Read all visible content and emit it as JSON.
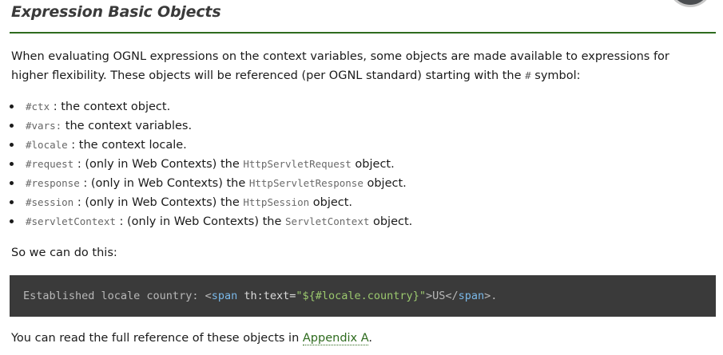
{
  "heading": "Expression Basic Objects",
  "intro": {
    "part1": "When evaluating OGNL expressions on the context variables, some objects are made available to expressions for higher flexibility. These objects will be referenced (per OGNL standard) starting with the ",
    "hash": "#",
    "part2": " symbol:"
  },
  "objects": [
    {
      "key": "#ctx",
      "sep": " : ",
      "text1": "the context object.",
      "type": "",
      "text2": ""
    },
    {
      "key": "#vars:",
      "sep": "  ",
      "text1": "the context variables.",
      "type": "",
      "text2": ""
    },
    {
      "key": "#locale",
      "sep": " : ",
      "text1": "the context locale.",
      "type": "",
      "text2": ""
    },
    {
      "key": "#request",
      "sep": " : ",
      "text1": "(only in Web Contexts) the ",
      "type": "HttpServletRequest",
      "text2": " object."
    },
    {
      "key": "#response",
      "sep": " : ",
      "text1": "(only in Web Contexts) the ",
      "type": "HttpServletResponse",
      "text2": " object."
    },
    {
      "key": "#session",
      "sep": " : ",
      "text1": "(only in Web Contexts) the ",
      "type": "HttpSession",
      "text2": " object."
    },
    {
      "key": "#servletContext",
      "sep": " : ",
      "text1": "(only in Web Contexts) the ",
      "type": "ServletContext",
      "text2": " object."
    }
  ],
  "so_we_can": "So we can do this:",
  "code": {
    "prefix": "Established locale country: ",
    "lt": "<",
    "tag": "span",
    "attr": " th:text=",
    "value": "\"${#locale.country}\"",
    "content": ">US</",
    "tag_close": "span",
    "suffix": ">."
  },
  "outro": {
    "text": "You can read the full reference of these objects in ",
    "link": "Appendix A",
    "end": "."
  }
}
